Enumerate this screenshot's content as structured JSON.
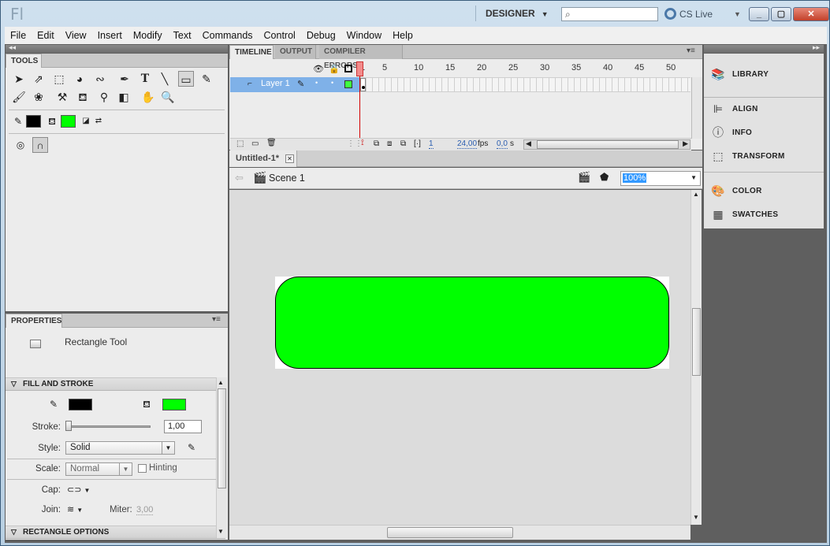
{
  "titlebar": {
    "logo": "Fl",
    "workspace": "DESIGNER",
    "search_placeholder": "",
    "cslive": "CS Live",
    "min": "_",
    "max": "▢",
    "close": "✕"
  },
  "menu": [
    "File",
    "Edit",
    "View",
    "Insert",
    "Modify",
    "Text",
    "Commands",
    "Control",
    "Debug",
    "Window",
    "Help"
  ],
  "tools_panel": {
    "title": "TOOLS"
  },
  "timeline": {
    "tabs": [
      "TIMELINE",
      "OUTPUT",
      "COMPILER ERRORS"
    ],
    "ruler": [
      "1",
      "5",
      "10",
      "15",
      "20",
      "25",
      "30",
      "35",
      "40",
      "45",
      "50"
    ],
    "layer_name": "Layer 1",
    "fps": "24,00",
    "fps_unit": "fps",
    "time": "0,0",
    "time_unit": "s",
    "frame": "1"
  },
  "document": {
    "tab_title": "Untitled-1*",
    "scene": "Scene 1",
    "zoom": "100%"
  },
  "stage": {
    "rect_fill": "#00ff00",
    "stroke_color": "#000000"
  },
  "properties": {
    "title": "PROPERTIES",
    "tool_name": "Rectangle Tool",
    "fill_stroke_header": "FILL AND STROKE",
    "stroke_label": "Stroke:",
    "stroke_value": "1,00",
    "style_label": "Style:",
    "style_value": "Solid",
    "scale_label": "Scale:",
    "scale_value": "Normal",
    "hinting_label": "Hinting",
    "cap_label": "Cap:",
    "join_label": "Join:",
    "miter_label": "Miter:",
    "miter_value": "3,00",
    "rect_options_header": "RECTANGLE OPTIONS"
  },
  "right_panel": {
    "groups": [
      [
        {
          "icon": "library-icon",
          "label": "LIBRARY"
        }
      ],
      [
        {
          "icon": "align-icon",
          "label": "ALIGN"
        },
        {
          "icon": "info-icon",
          "label": "INFO"
        },
        {
          "icon": "transform-icon",
          "label": "TRANSFORM"
        }
      ],
      [
        {
          "icon": "color-icon",
          "label": "COLOR"
        },
        {
          "icon": "swatches-icon",
          "label": "SWATCHES"
        }
      ]
    ]
  }
}
